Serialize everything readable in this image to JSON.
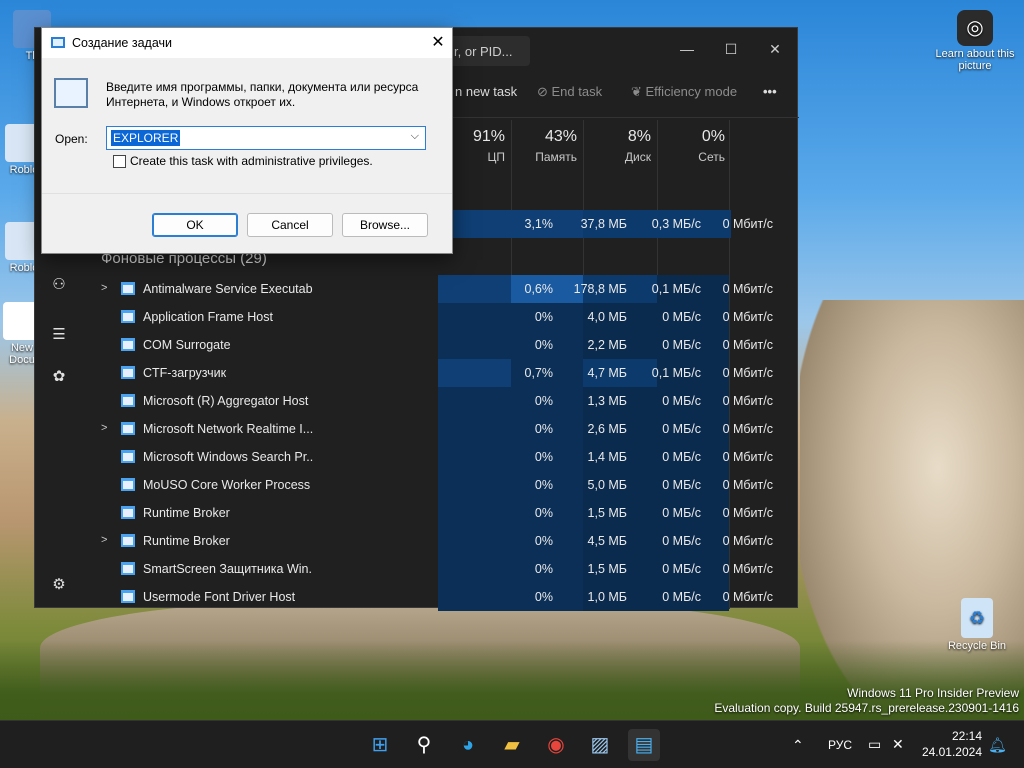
{
  "desktop": {
    "icons": [
      {
        "label": "Th"
      },
      {
        "label": "Roblo"
      },
      {
        "label": "Roblo"
      },
      {
        "label": "New Docu"
      }
    ],
    "learn": {
      "label": "Learn about this picture"
    },
    "recycle": {
      "label": "Recycle Bin"
    },
    "watermark": {
      "line1": "Windows 11 Pro Insider Preview",
      "line2": "Evaluation copy. Build 25947.rs_prerelease.230901-1416"
    }
  },
  "taskmanager": {
    "search_placeholder": "r, or PID...",
    "cmd": {
      "run_new_task": "n new task",
      "end_task": "End task",
      "efficiency_mode": "Efficiency mode",
      "more": "•••"
    },
    "headers": [
      {
        "pct": "91%",
        "label": "ЦП"
      },
      {
        "pct": "43%",
        "label": "Память"
      },
      {
        "pct": "8%",
        "label": "Диск"
      },
      {
        "pct": "0%",
        "label": "Сеть"
      }
    ],
    "top_row": {
      "cpu": "3,1%",
      "mem": "37,8 МБ",
      "disk": "0,3 МБ/с",
      "net": "0 Мбит/с"
    },
    "group_label": "Фоновые процессы (29)",
    "rows": [
      {
        "expand": ">",
        "name": "Antimalware Service Executable",
        "cpu": "0,6%",
        "mem": "178,8 МБ",
        "disk": "0,1 МБ/с",
        "net": "0 Мбит/с"
      },
      {
        "expand": "",
        "name": "Application Frame Host",
        "cpu": "0%",
        "mem": "4,0 МБ",
        "disk": "0 МБ/с",
        "net": "0 Мбит/с"
      },
      {
        "expand": "",
        "name": "COM Surrogate",
        "cpu": "0%",
        "mem": "2,2 МБ",
        "disk": "0 МБ/с",
        "net": "0 Мбит/с"
      },
      {
        "expand": "",
        "name": "CTF-загрузчик",
        "cpu": "0,7%",
        "mem": "4,7 МБ",
        "disk": "0,1 МБ/с",
        "net": "0 Мбит/с"
      },
      {
        "expand": "",
        "name": "Microsoft (R) Aggregator Host",
        "cpu": "0%",
        "mem": "1,3 МБ",
        "disk": "0 МБ/с",
        "net": "0 Мбит/с"
      },
      {
        "expand": ">",
        "name": "Microsoft Network Realtime I...",
        "cpu": "0%",
        "mem": "2,6 МБ",
        "disk": "0 МБ/с",
        "net": "0 Мбит/с"
      },
      {
        "expand": "",
        "name": "Microsoft Windows Search Pr...",
        "cpu": "0%",
        "mem": "1,4 МБ",
        "disk": "0 МБ/с",
        "net": "0 Мбит/с"
      },
      {
        "expand": "",
        "name": "MoUSO Core Worker Process",
        "cpu": "0%",
        "mem": "5,0 МБ",
        "disk": "0 МБ/с",
        "net": "0 Мбит/с"
      },
      {
        "expand": "",
        "name": "Runtime Broker",
        "cpu": "0%",
        "mem": "1,5 МБ",
        "disk": "0 МБ/с",
        "net": "0 Мбит/с"
      },
      {
        "expand": ">",
        "name": "Runtime Broker",
        "cpu": "0%",
        "mem": "4,5 МБ",
        "disk": "0 МБ/с",
        "net": "0 Мбит/с"
      },
      {
        "expand": "",
        "name": "SmartScreen Защитника Win...",
        "cpu": "0%",
        "mem": "1,5 МБ",
        "disk": "0 МБ/с",
        "net": "0 Мбит/с"
      },
      {
        "expand": "",
        "name": "Usermode Font Driver Host",
        "cpu": "0%",
        "mem": "1,0 МБ",
        "disk": "0 МБ/с",
        "net": "0 Мбит/с"
      }
    ]
  },
  "dialog": {
    "title": "Создание задачи",
    "close": "✕",
    "message": "Введите имя программы, папки, документа или ресурса Интернета, и Windows откроет их.",
    "open_label": "Open:",
    "open_value": "EXPLORER",
    "admin_label": "Create this task with administrative privileges.",
    "ok": "OK",
    "cancel": "Cancel",
    "browse": "Browse..."
  },
  "taskbar": {
    "lang": "РУС",
    "time": "22:14",
    "date": "24.01.2024"
  }
}
